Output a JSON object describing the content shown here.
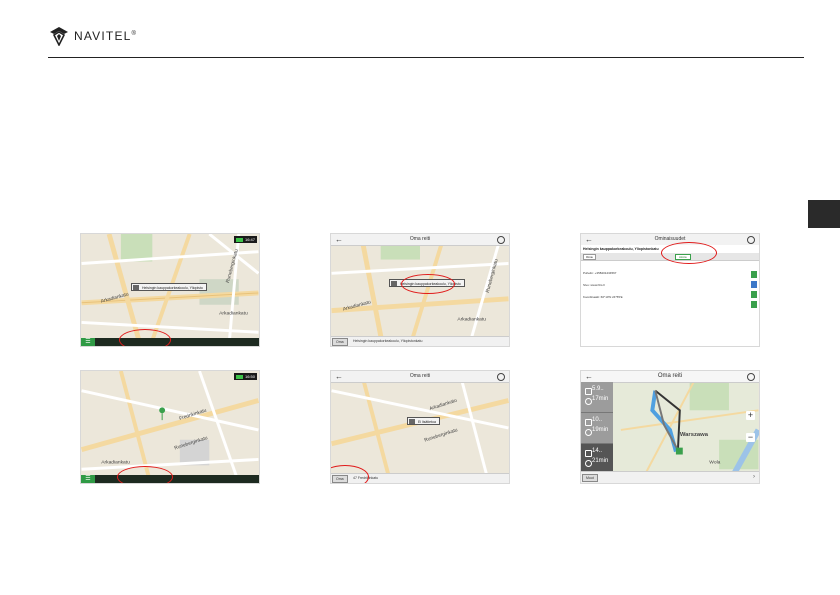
{
  "brand": {
    "name": "NAVITEL",
    "reg": "®"
  },
  "screens": {
    "s1": {
      "battery": "16:47",
      "popup": "Helsingin kauppakorkeakoulu, Yliopisto",
      "street_labels": [
        "Arkadiankatu",
        "Arkadiankatu",
        "Runeberginkatu"
      ]
    },
    "s2": {
      "title": "Oma reiti",
      "popup": "Helsingin kauppakorkeakoulu, Yliopisto",
      "info_btn": "Oma",
      "info_text": "Helsingin kauppakorkeakoulu, Yliopistonkatu",
      "street_labels": [
        "Arkadiankatu",
        "Arkadiankatu",
        "Runeberginkatu"
      ]
    },
    "s3": {
      "title": "Ominaisuudet",
      "header": "Helsingin kauppakorkeakoulu, Yliopistonkatu",
      "toolbar_btn": "Oma",
      "action_btn": "Aloita",
      "rows": [
        "Puhelin: +358401234567",
        "Sivu: www.hhs.fi",
        "Koordinaatit: 60°10'N 24°55'E"
      ]
    },
    "s4": {
      "battery": "16:50",
      "street_labels": [
        "Fredrikinkatu",
        "Runeberginkatu",
        "Arkadiankatu"
      ]
    },
    "s5": {
      "title": "Oma reiti",
      "popup": "Ei lisätietoa",
      "info_btn": "Oma",
      "info_text": "47 Fredrikinkatu",
      "street_labels": [
        "Arkadiankatu",
        "Runeberginkatu"
      ]
    },
    "s6": {
      "title": "Oma reiti",
      "dist1": "5.9..",
      "time1": "17min",
      "dist2": "10..",
      "time2": "19min",
      "dist3": "14..",
      "time3": "21min",
      "menu_btn": "Muut",
      "city": "Warszawa",
      "sub": "Wola"
    }
  }
}
